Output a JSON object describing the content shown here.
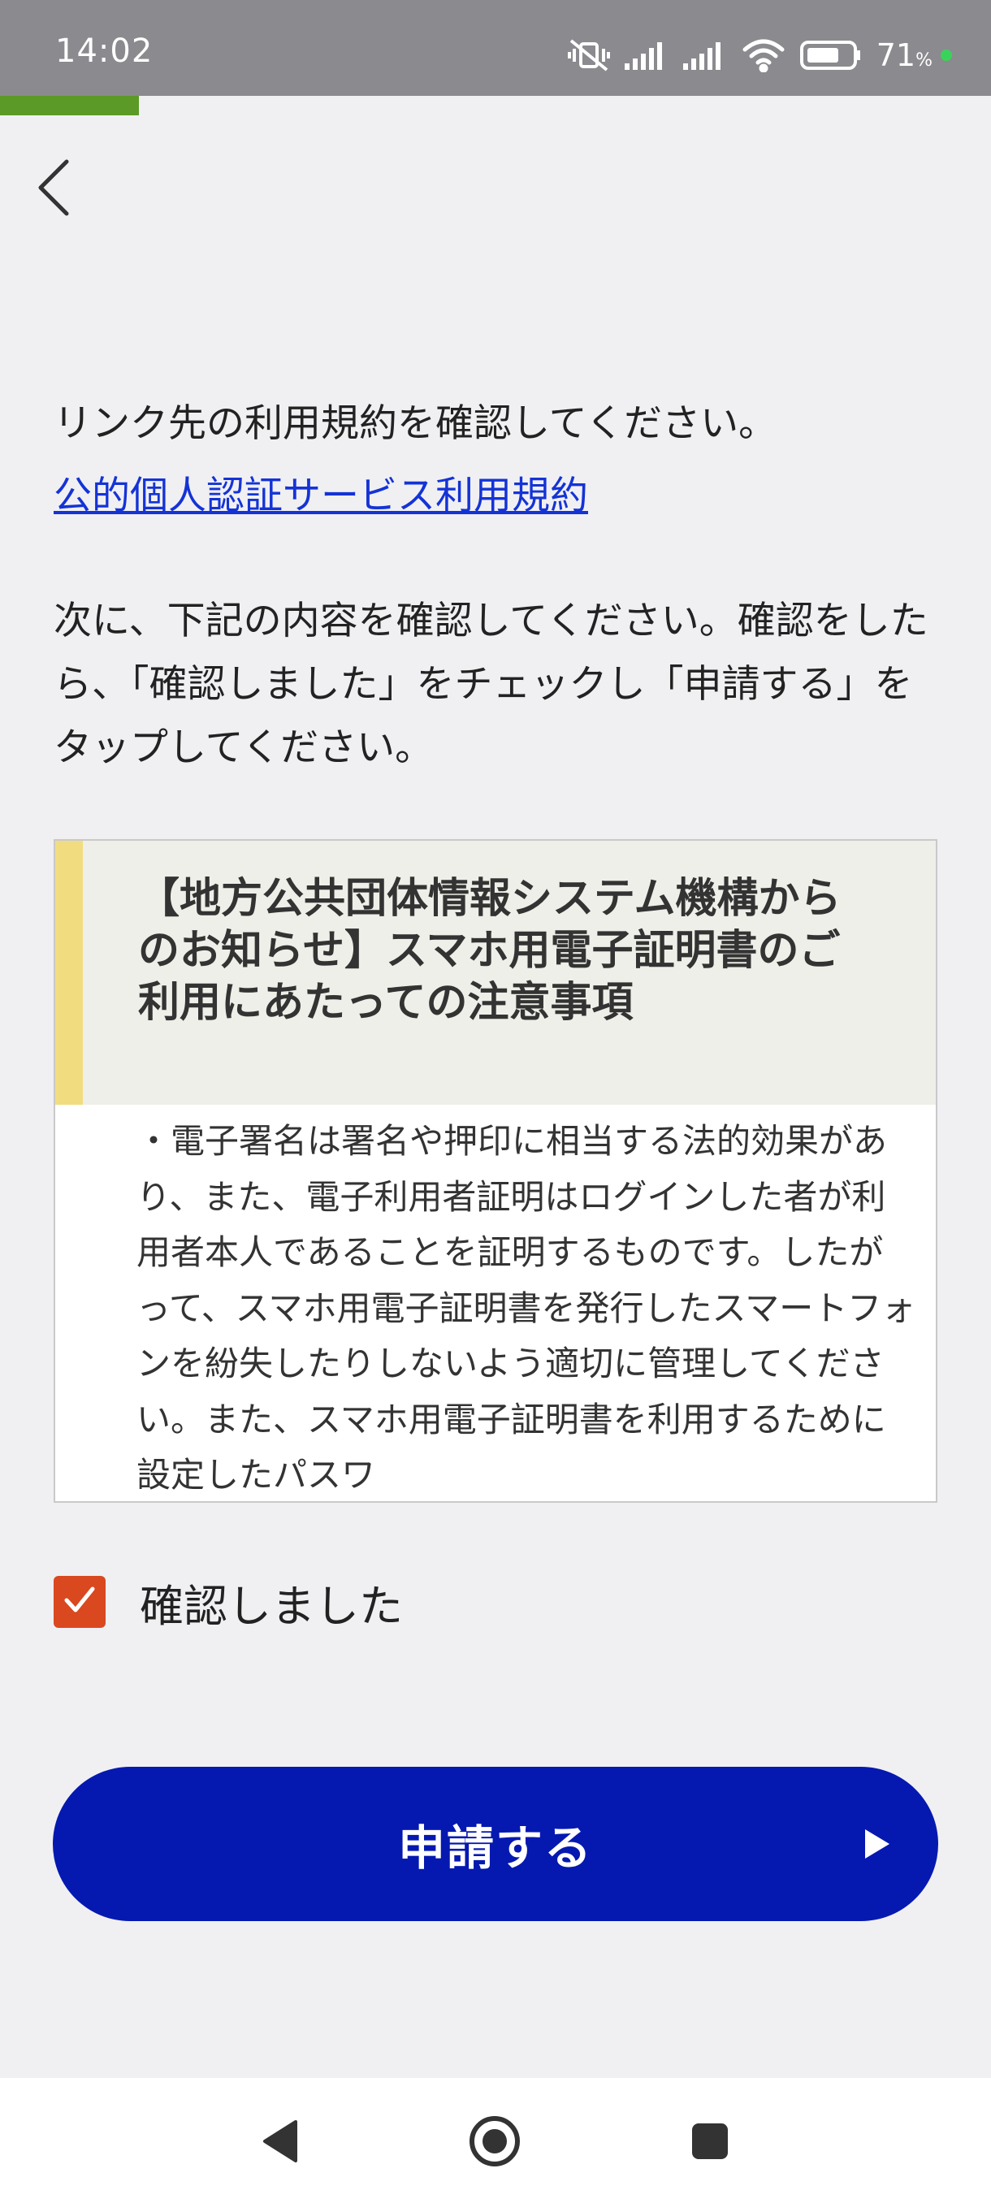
{
  "status_bar": {
    "time": "14:02",
    "battery_percent": "71",
    "battery_unit": "%",
    "icons": [
      "mute-vibrate-icon",
      "signal-icon",
      "signal-icon",
      "wifi-icon",
      "battery-icon",
      "camera-indicator-dot"
    ],
    "background_color": "#8a8a8f"
  },
  "progress": {
    "fraction": 0.14,
    "color": "#5b9a26"
  },
  "nav": {
    "back_icon": "chevron-left-icon"
  },
  "content": {
    "intro": "リンク先の利用規約を確認してください。",
    "terms_link": "公的個人認証サービス利用規約",
    "instruction": "次に、下記の内容を確認してください。確認をしたら、「確認しました」をチェックし「申請する」をタップしてください。"
  },
  "notice": {
    "title": "【地方公共団体情報システム機構からのお知らせ】スマホ用電子証明書のご利用にあたっての注意事項",
    "body": "・電子署名は署名や押印に相当する法的効果があり、また、電子利用者証明はログインした者が利用者本人であることを証明するものです。したがって、スマホ用電子証明書を発行したスマートフォンを紛失したりしないよう適切に管理してください。また、スマホ用電子証明書を利用するために設定したパスワ",
    "accent_color": "#f2dc80"
  },
  "confirm": {
    "label": "確認しました",
    "checked": true,
    "color": "#d9481f"
  },
  "apply_button": {
    "label": "申請する",
    "color": "#0519b0"
  },
  "system_nav": {
    "icons": [
      "back-triangle-icon",
      "home-circle-icon",
      "recents-square-icon"
    ]
  }
}
